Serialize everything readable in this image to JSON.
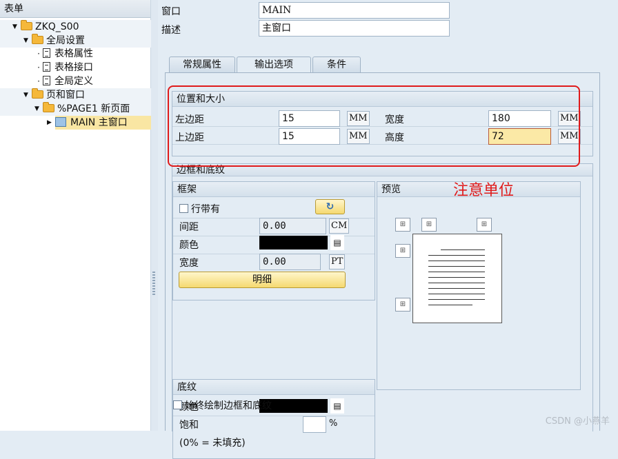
{
  "tree": {
    "header": "表单",
    "items": [
      {
        "label": "ZKQ_S00"
      },
      {
        "label": "全局设置"
      },
      {
        "label": "表格属性"
      },
      {
        "label": "表格接口"
      },
      {
        "label": "全局定义"
      },
      {
        "label": "页和窗口"
      },
      {
        "label": "%PAGE1 新页面"
      },
      {
        "label": "MAIN 主窗口"
      }
    ]
  },
  "header_form": {
    "window_label": "窗口",
    "window_value": "MAIN",
    "desc_label": "描述",
    "desc_value": "主窗口"
  },
  "tabs": [
    {
      "label": "常规属性"
    },
    {
      "label": "输出选项"
    },
    {
      "label": "条件"
    }
  ],
  "position_size": {
    "title": "位置和大小",
    "left_margin_label": "左边距",
    "left_margin_value": "15",
    "left_margin_unit": "MM",
    "top_margin_label": "上边距",
    "top_margin_value": "15",
    "top_margin_unit": "MM",
    "width_label": "宽度",
    "width_value": "180",
    "width_unit": "MM",
    "height_label": "高度",
    "height_value": "72",
    "height_unit": "MM"
  },
  "border_shading": {
    "title": "边框和底纹",
    "frame": {
      "title": "框架",
      "with_line_label": "行带有",
      "spacing_label": "间距",
      "spacing_value": "0.00",
      "spacing_unit": "CM",
      "color_label": "颜色",
      "width_label": "宽度",
      "width_value": "0.00",
      "width_unit": "PT",
      "detail_button": "明细"
    },
    "preview": {
      "title": "预览"
    },
    "shading": {
      "title": "底纹",
      "color_label": "颜色",
      "saturation_label": "饱和",
      "saturation_unit": "%",
      "note": "(0% = 未填充)"
    },
    "always_draw_label": "始终绘制边框和底纹"
  },
  "annotation": "注意单位",
  "watermark": "CSDN @小燕羊"
}
